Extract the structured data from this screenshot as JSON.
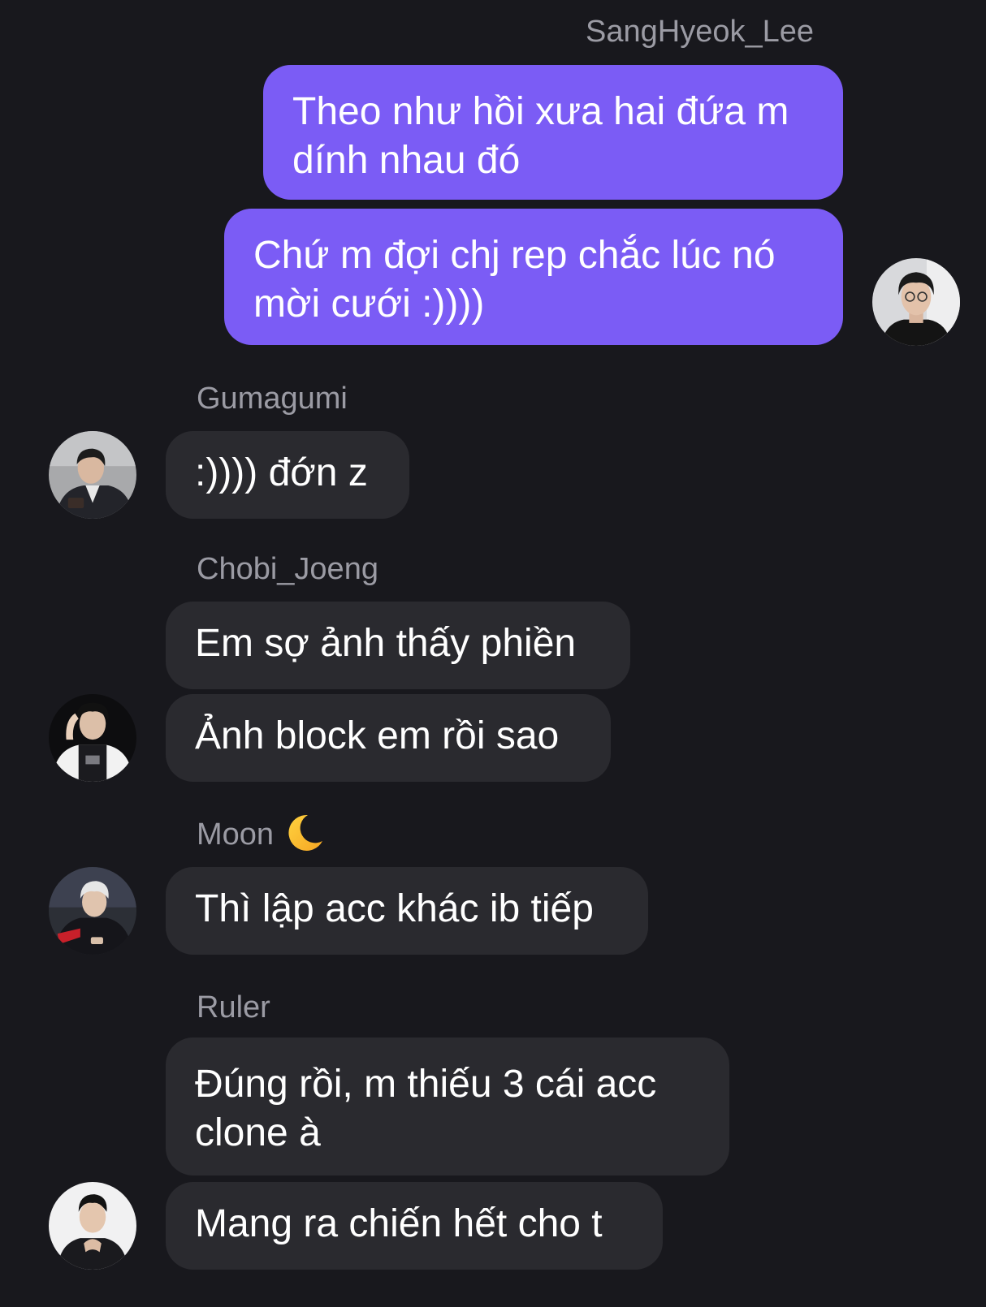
{
  "messages": {
    "own": {
      "sender": "SangHyeok_Lee",
      "lines": [
        "Theo như hồi xưa hai đứa m dính nhau đó",
        "Chứ m đợi chj rep chắc lúc nó mời cưới :))))"
      ]
    },
    "gumagumi": {
      "sender": "Gumagumi",
      "lines": [
        ":)))) đớn z"
      ]
    },
    "chobi": {
      "sender": "Chobi_Joeng",
      "lines": [
        "Em sợ ảnh thấy phiền",
        "Ảnh block em rồi sao"
      ]
    },
    "moon": {
      "sender": "Moon",
      "sender_icon": "crescent-moon-icon",
      "lines": [
        "Thì lập acc khác ib tiếp"
      ]
    },
    "ruler": {
      "sender": "Ruler",
      "lines": [
        "Đúng rồi, m thiếu 3 cái acc clone à",
        "Mang ra chiến hết cho t"
      ]
    }
  },
  "colors": {
    "background": "#18181d",
    "outgoing_bubble": "#7b5cf5",
    "incoming_bubble": "#2a2a2f",
    "sender_name": "#9b9ba4",
    "text": "#ffffff"
  }
}
